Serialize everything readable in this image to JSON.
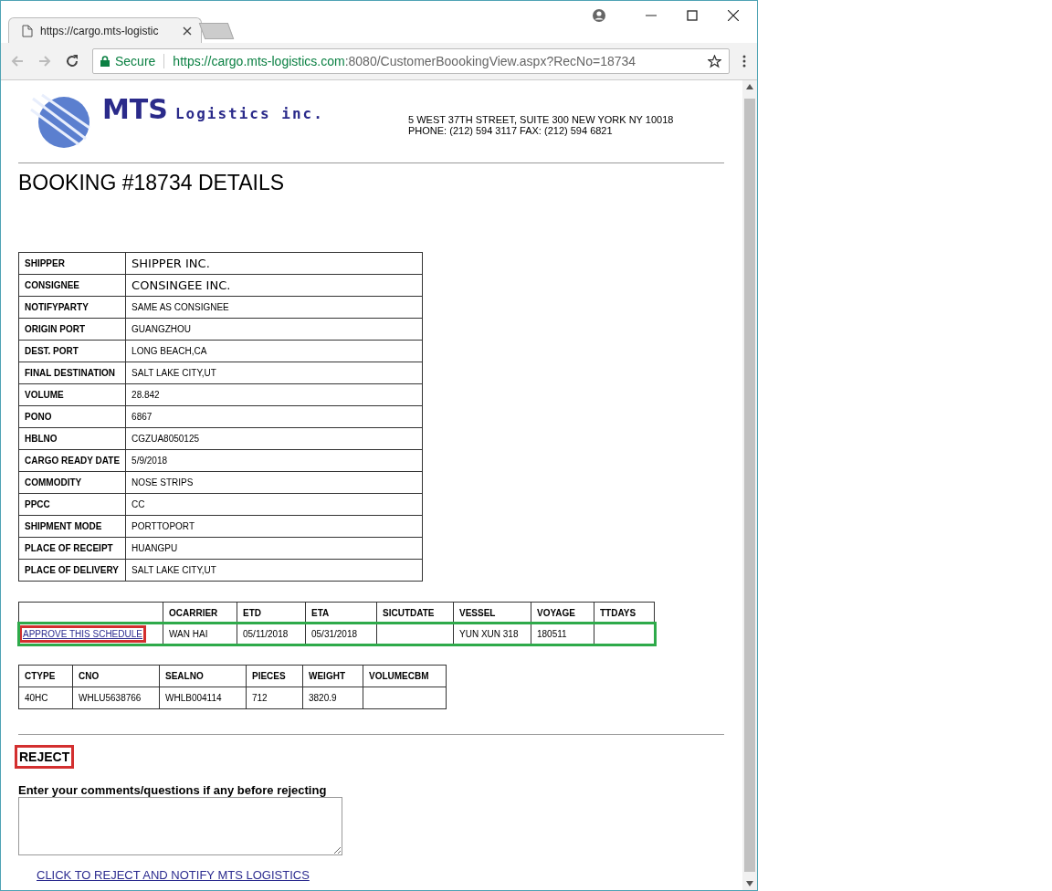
{
  "browser": {
    "tab_title": "https://cargo.mts-logistic",
    "url_host": "https://cargo.mts-logistics.com",
    "url_rest": ":8080/CustomerBoookingView.aspx?RecNo=18734",
    "secure_label": "Secure"
  },
  "header": {
    "logo_mark": "MTS",
    "logo_text": "Logistics inc.",
    "address": "5 WEST 37TH STREET, SUITE 300 NEW YORK NY 10018",
    "phone": "PHONE: (212) 594 3117 FAX: (212) 594 6821"
  },
  "title": "BOOKING #18734 DETAILS",
  "details": [
    {
      "label": "SHIPPER",
      "value": "SHIPPER INC.",
      "kind": "large"
    },
    {
      "label": "CONSIGNEE",
      "value": "CONSINGEE INC.",
      "kind": "large"
    },
    {
      "label": "NOTIFYPARTY",
      "value": "SAME AS CONSIGNEE",
      "kind": "plain"
    },
    {
      "label": "ORIGIN PORT",
      "value": "GUANGZHOU",
      "kind": "plain"
    },
    {
      "label": "DEST. PORT",
      "value": "LONG BEACH,CA",
      "kind": "plain"
    },
    {
      "label": "FINAL DESTINATION",
      "value": "SALT LAKE CITY,UT",
      "kind": "plain"
    },
    {
      "label": "VOLUME",
      "value": "28.842",
      "kind": "plain"
    },
    {
      "label": "PONO",
      "value": "6867",
      "kind": "plain"
    },
    {
      "label": "HBLNO",
      "value": "CGZUA8050125",
      "kind": "plain"
    },
    {
      "label": "CARGO READY DATE",
      "value": "5/9/2018",
      "kind": "plain"
    },
    {
      "label": "COMMODITY",
      "value": "NOSE STRIPS",
      "kind": "plain"
    },
    {
      "label": "PPCC",
      "value": "CC",
      "kind": "plain"
    },
    {
      "label": "SHIPMENT MODE",
      "value": "PORTTOPORT",
      "kind": "plain"
    },
    {
      "label": "PLACE OF RECEIPT",
      "value": "HUANGPU",
      "kind": "plain"
    },
    {
      "label": "PLACE OF DELIVERY",
      "value": "SALT LAKE CITY,UT",
      "kind": "plain"
    }
  ],
  "schedule": {
    "columns": [
      "OCARRIER",
      "ETD",
      "ETA",
      "SICUTDATE",
      "VESSEL",
      "VOYAGE",
      "TTDAYS"
    ],
    "row": {
      "approve_link": "APPROVE THIS SCHEDULE",
      "link_highlighted": true,
      "highlighted": true,
      "cells": [
        "WAN HAI",
        "05/11/2018",
        "05/31/2018",
        "",
        "YUN XUN 318",
        "180511",
        ""
      ]
    }
  },
  "containers": {
    "columns": [
      "CTYPE",
      "CNO",
      "SEALNO",
      "PIECES",
      "WEIGHT",
      "VOLUMECBM"
    ],
    "rows": [
      [
        "40HC",
        "WHLU5638766",
        "WHLB004114",
        "712",
        "3820.9",
        ""
      ]
    ]
  },
  "reject": {
    "heading": "REJECT",
    "highlighted": true,
    "comment_label": "Enter your comments/questions if any before rejecting",
    "link": "CLICK TO REJECT AND NOTIFY MTS LOGISTICS"
  }
}
